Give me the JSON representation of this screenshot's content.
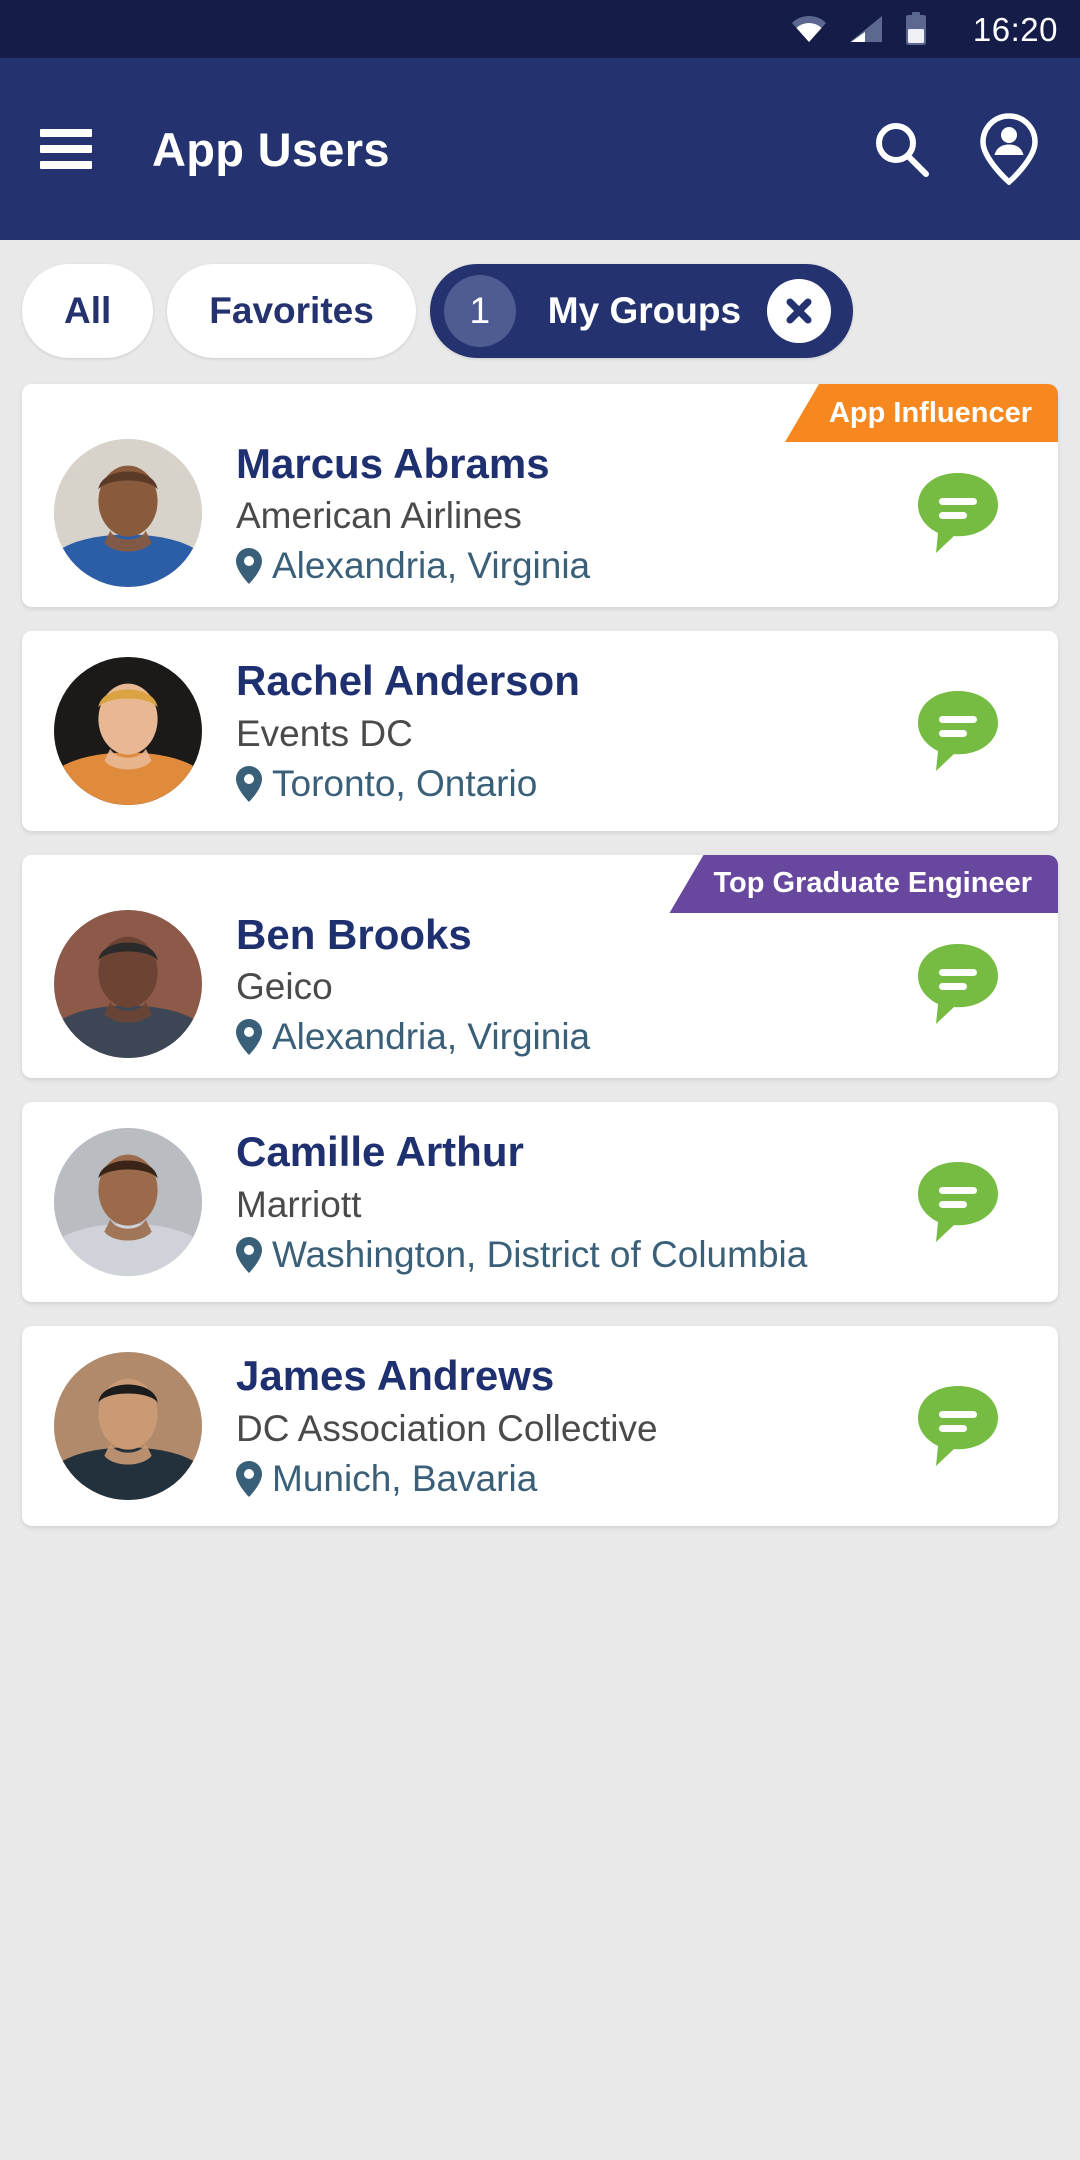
{
  "status_bar": {
    "time": "16:20",
    "icons": [
      "wifi-icon",
      "cellular-signal-icon",
      "battery-icon"
    ]
  },
  "app_bar": {
    "menu_icon": "hamburger-menu-icon",
    "title": "App Users",
    "actions": [
      {
        "icon": "search-icon",
        "label": "Search"
      },
      {
        "icon": "account-location-pin-icon",
        "label": "Nearby users"
      }
    ]
  },
  "filters": {
    "chips": [
      {
        "label": "All",
        "active": false
      },
      {
        "label": "Favorites",
        "active": false
      }
    ],
    "active_chip": {
      "count": "1",
      "label": "My Groups",
      "close_icon": "close-x-icon"
    }
  },
  "colors": {
    "status_bar": "#141c47",
    "app_bar": "#24336f",
    "page_background": "#e9e9e9",
    "card_background": "#ffffff",
    "name_text": "#1f3070",
    "company_text": "#4a4a4a",
    "location_text": "#3a5f78",
    "chat_green": "#76bc43",
    "badge_orange": "#f6881f",
    "badge_purple": "#68479f",
    "chip_count_circle": "#4e5c92"
  },
  "users": [
    {
      "name": "Marcus Abrams",
      "company": "American Airlines",
      "location": "Alexandria, Virginia",
      "badge": {
        "text": "App Influencer",
        "color": "#f6881f"
      },
      "chat_icon": "chat-bubble-icon",
      "pin_icon": "map-pin-icon",
      "avatar": "photo-man-blue-blazer"
    },
    {
      "name": "Rachel Anderson",
      "company": "Events DC",
      "location": "Toronto, Ontario",
      "badge": null,
      "chat_icon": "chat-bubble-icon",
      "pin_icon": "map-pin-icon",
      "avatar": "photo-woman-blonde-orange-top"
    },
    {
      "name": "Ben Brooks",
      "company": "Geico",
      "location": "Alexandria, Virginia",
      "badge": {
        "text": "Top Graduate Engineer",
        "color": "#68479f"
      },
      "chat_icon": "chat-bubble-icon",
      "pin_icon": "map-pin-icon",
      "avatar": "photo-man-plaid-shirt-blazer"
    },
    {
      "name": "Camille Arthur",
      "company": "Marriott",
      "location": "Washington, District of Columbia",
      "badge": null,
      "chat_icon": "chat-bubble-icon",
      "pin_icon": "map-pin-icon",
      "avatar": "photo-woman-curly-hair-grey-top"
    },
    {
      "name": "James Andrews",
      "company": "DC Association Collective",
      "location": "Munich, Bavaria",
      "badge": null,
      "chat_icon": "chat-bubble-icon",
      "pin_icon": "map-pin-icon",
      "avatar": "photo-man-dark-suit-brick-wall"
    }
  ]
}
